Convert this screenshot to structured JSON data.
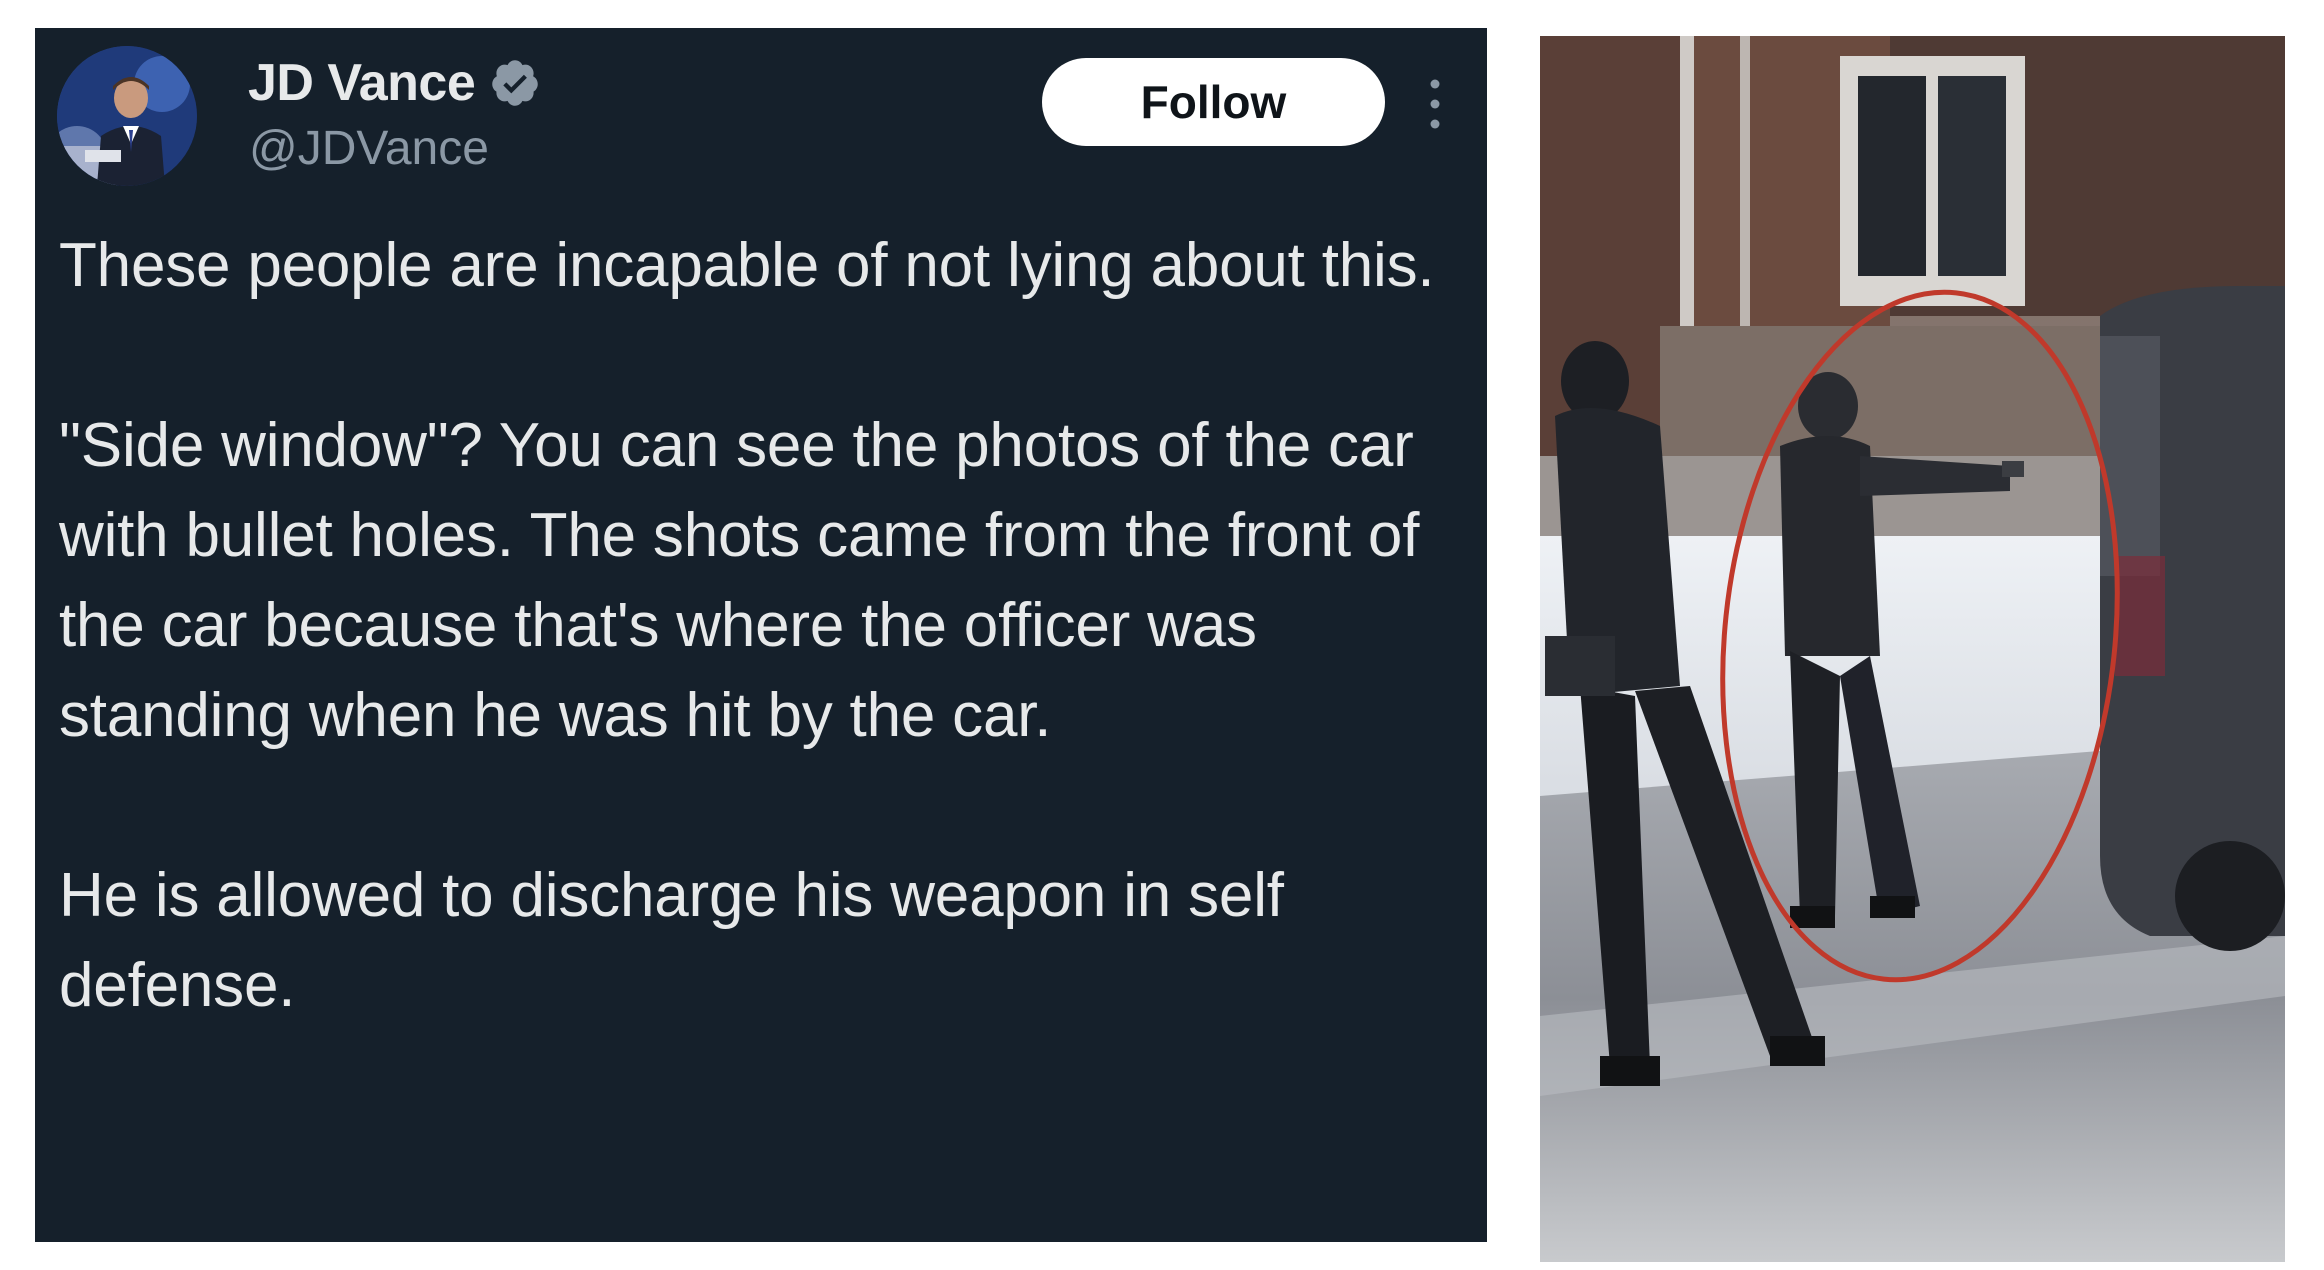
{
  "tweet": {
    "author": {
      "display_name": "JD Vance",
      "handle": "@JDVance",
      "verified": true
    },
    "follow_label": "Follow",
    "paragraphs": [
      "These people are incapable of not lying about this.",
      "\"Side window\"? You can see the photos of the car with bullet holes. The shots came from the front of the car because that's where the officer was standing when he was hit by the car.",
      "He is allowed to discharge his weapon in self defense."
    ]
  },
  "icons": {
    "verified": "verified-badge-icon",
    "more": "more-vertical-icon"
  },
  "colors": {
    "card_background": "#15202b",
    "text_primary": "#e7e9ea",
    "text_secondary": "#8b98a5",
    "verified_badge": "#8b98a5",
    "follow_button_bg": "#ffffff",
    "follow_button_text": "#0f1419",
    "annotation_circle": "#c0392b"
  },
  "photo": {
    "description_visible": "street scene with two figures and a vehicle, a figure circled in red"
  }
}
